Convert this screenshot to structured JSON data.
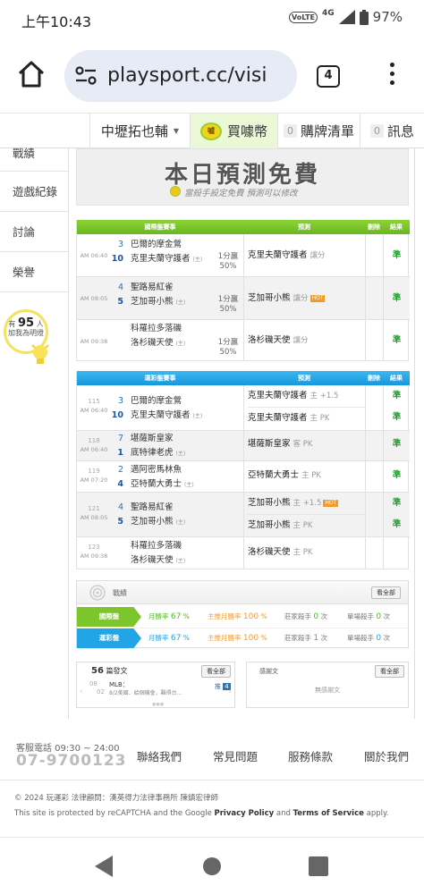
{
  "status_bar": {
    "time": "上午10:43",
    "network": "4G",
    "battery": "97%",
    "volte": "VoLTE"
  },
  "browser": {
    "url": "playsport.cc/visi",
    "tab_count": "4"
  },
  "site_nav": {
    "user_menu": "中壢拓也輔",
    "coins_icon_text": "噓",
    "coins_label": "買噱幣",
    "cart_count": "0",
    "cart_label": "購牌清單",
    "msg_count": "0",
    "msg_label": "訊息"
  },
  "sidebar": {
    "items": [
      "戰績",
      "遊戲紀錄",
      "討論",
      "榮譽"
    ],
    "followers_prefix": "有",
    "followers_count": "95",
    "followers_suffix": "人",
    "followers_note": "加我為明燈"
  },
  "banner": {
    "title": "本日預測免費",
    "subtitle": "當殺手設定免費 預測可以修改"
  },
  "intl_table": {
    "headers": [
      "國際盤賽事",
      "預測",
      "刪除",
      "結果"
    ],
    "rows": [
      {
        "time": "AM 06:40",
        "n1": "3",
        "n2": "10",
        "team1": "巴爾的摩金鶯",
        "team2": "克里夫蘭守護者",
        "host": "(主)",
        "odds1": "1分贏",
        "odds2": "50%",
        "pred": "克里夫蘭守護者",
        "pred_sub": "讓分",
        "hot": "",
        "result": "準"
      },
      {
        "time": "AM 08:05",
        "n1": "4",
        "n2": "5",
        "team1": "聖路易紅雀",
        "team2": "芝加哥小熊",
        "host": "(主)",
        "odds1": "1分贏",
        "odds2": "50%",
        "pred": "芝加哥小熊",
        "pred_sub": "讓分",
        "hot": "HOT",
        "result": "準"
      },
      {
        "time": "AM 09:38",
        "n1": "",
        "n2": "",
        "team1": "科羅拉多落磯",
        "team2": "洛杉磯天使",
        "host": "(主)",
        "odds1": "1分贏",
        "odds2": "50%",
        "pred": "洛杉磯天使",
        "pred_sub": "讓分",
        "hot": "",
        "result": "準"
      }
    ]
  },
  "tw_table": {
    "headers": [
      "運彩盤賽事",
      "預測",
      "刪除",
      "結果"
    ],
    "rows": [
      {
        "id": "115",
        "time": "AM 06:40",
        "n1": "3",
        "n2": "10",
        "team1": "巴爾的摩金鶯",
        "team2": "克里夫蘭守護者",
        "host": "(主)",
        "preds": [
          {
            "team": "克里夫蘭守護者",
            "sub": "主 +1.5",
            "hot": "",
            "result": "準"
          },
          {
            "team": "克里夫蘭守護者",
            "sub": "主 PK",
            "hot": "",
            "result": "準"
          }
        ]
      },
      {
        "id": "118",
        "time": "AM 06:40",
        "n1": "7",
        "n2": "1",
        "team1": "堪薩斯皇家",
        "team2": "底特律老虎",
        "host": "(主)",
        "preds": [
          {
            "team": "堪薩斯皇家",
            "sub": "客 PK",
            "hot": "",
            "result": "準"
          }
        ]
      },
      {
        "id": "119",
        "time": "AM 07:20",
        "n1": "2",
        "n2": "4",
        "team1": "邁阿密馬林魚",
        "team2": "亞特蘭大勇士",
        "host": "(主)",
        "preds": [
          {
            "team": "亞特蘭大勇士",
            "sub": "主 PK",
            "hot": "",
            "result": "準"
          }
        ]
      },
      {
        "id": "121",
        "time": "AM 08:05",
        "n1": "4",
        "n2": "5",
        "team1": "聖路易紅雀",
        "team2": "芝加哥小熊",
        "host": "(主)",
        "preds": [
          {
            "team": "芝加哥小熊",
            "sub": "主 +1.5",
            "hot": "HOT",
            "result": "準"
          },
          {
            "team": "芝加哥小熊",
            "sub": "主 PK",
            "hot": "",
            "result": "準"
          }
        ]
      },
      {
        "id": "123",
        "time": "AM 09:38",
        "n1": "",
        "n2": "",
        "team1": "科羅拉多落磯",
        "team2": "洛杉磯天使",
        "host": "(主)",
        "preds": [
          {
            "team": "洛杉磯天使",
            "sub": "主 PK",
            "hot": "",
            "result": ""
          }
        ]
      }
    ]
  },
  "stats": {
    "title": "戰績",
    "view_all": "看全部",
    "rows": [
      {
        "label": "國際盤",
        "month_rate_label": "月勝率",
        "month_rate": "67",
        "main_rate_label": "主推月勝率",
        "main_rate": "100",
        "killer_label": "莊家殺手",
        "killer": "0",
        "killer_unit": "次",
        "single_label": "單場殺手",
        "single": "0",
        "single_unit": "次"
      },
      {
        "label": "運彩盤",
        "month_rate_label": "月勝率",
        "month_rate": "67",
        "main_rate_label": "主推月勝率",
        "main_rate": "100",
        "killer_label": "莊家殺手",
        "killer": "1",
        "killer_unit": "次",
        "single_label": "單場殺手",
        "single": "0",
        "single_unit": "次"
      }
    ],
    "percent": "%"
  },
  "posts": {
    "count": "56",
    "label": "篇發文",
    "view_all": "看全部",
    "date_month": "08",
    "date_day": "02",
    "tag": "MLB：",
    "excerpt": "8/2美國．給個機會，難得台...",
    "push_label": "推",
    "push_count": "4"
  },
  "thanks": {
    "label": "感謝文",
    "view_all": "看全部",
    "empty": "無感謝文"
  },
  "footer": {
    "hotline_label": "客服電話 09:30 ~ 24:00",
    "phone": "07-9700123",
    "links": [
      "聯絡我們",
      "常見問題",
      "服務條款",
      "關於我們"
    ],
    "copyright": "© 2024 玩運彩 法律顧問：漢英得力法律事務所 陳鎮宏律師",
    "recaptcha_prefix": "This site is protected by reCAPTCHA and the Google ",
    "privacy": "Privacy Policy",
    "and": " and ",
    "terms": "Terms of Service",
    "apply": " apply."
  },
  "colors": {
    "intl_green": "#7cc52b",
    "tw_blue": "#22a5e6",
    "result_green": "#2aa134",
    "rate_green": "#4ebd1a",
    "rate_orange": "#f39b29"
  }
}
